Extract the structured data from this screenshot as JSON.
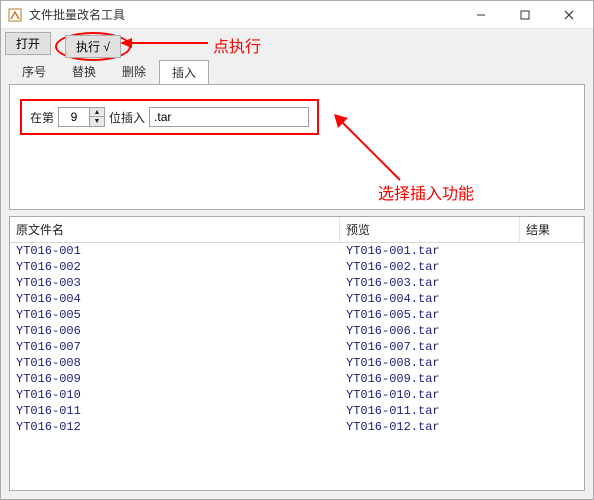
{
  "title": "文件批量改名工具",
  "toolbar": {
    "open": "打开",
    "execute": "执行 √"
  },
  "tabs": {
    "seq": "序号",
    "replace": "替换",
    "delete": "删除",
    "insert": "插入"
  },
  "insert": {
    "prefix": "在第",
    "position": "9",
    "mid": "位插入",
    "text": ".tar"
  },
  "annotations": {
    "click_exec": "点执行",
    "select_insert": "选择插入功能"
  },
  "table": {
    "headers": {
      "orig": "原文件名",
      "preview": "预览",
      "result": "结果"
    },
    "rows": [
      {
        "orig": "YT016-001",
        "prev": "YT016-001.tar"
      },
      {
        "orig": "YT016-002",
        "prev": "YT016-002.tar"
      },
      {
        "orig": "YT016-003",
        "prev": "YT016-003.tar"
      },
      {
        "orig": "YT016-004",
        "prev": "YT016-004.tar"
      },
      {
        "orig": "YT016-005",
        "prev": "YT016-005.tar"
      },
      {
        "orig": "YT016-006",
        "prev": "YT016-006.tar"
      },
      {
        "orig": "YT016-007",
        "prev": "YT016-007.tar"
      },
      {
        "orig": "YT016-008",
        "prev": "YT016-008.tar"
      },
      {
        "orig": "YT016-009",
        "prev": "YT016-009.tar"
      },
      {
        "orig": "YT016-010",
        "prev": "YT016-010.tar"
      },
      {
        "orig": "YT016-011",
        "prev": "YT016-011.tar"
      },
      {
        "orig": "YT016-012",
        "prev": "YT016-012.tar"
      }
    ]
  }
}
